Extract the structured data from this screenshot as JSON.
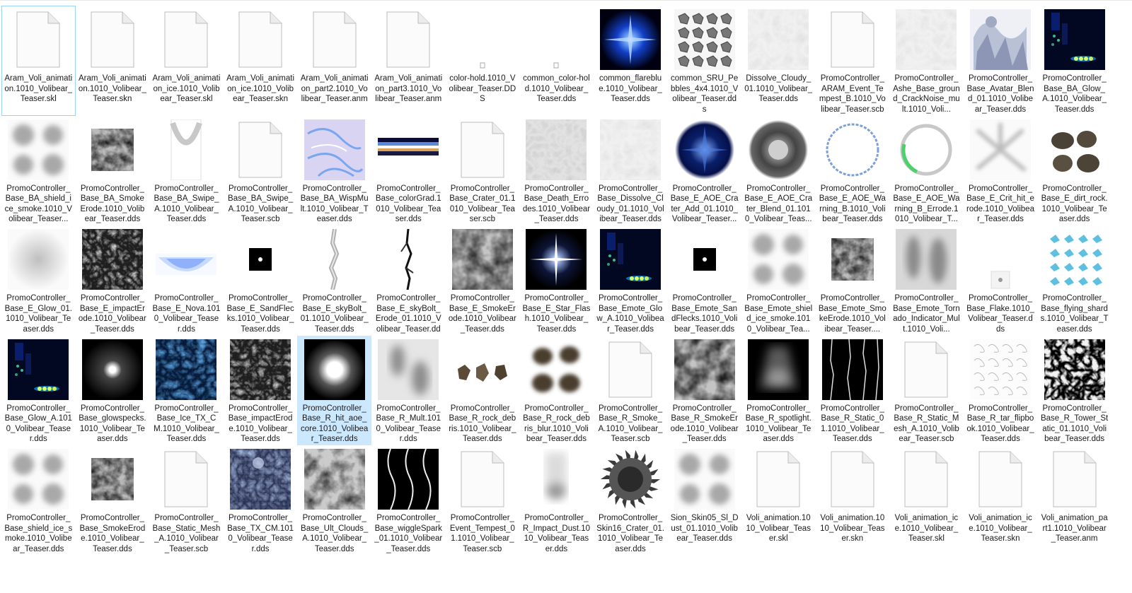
{
  "window": {
    "view": "Large icons"
  },
  "files": [
    {
      "name": "Aram_Voli_animation.1010_Volibear_Teaser.skl",
      "icon": "blank-file-icon",
      "focused": true
    },
    {
      "name": "Aram_Voli_animation.1010_Volibear_Teaser.skn",
      "icon": "blank-file-icon"
    },
    {
      "name": "Aram_Voli_animation_ice.1010_Volibear_Teaser.skl",
      "icon": "blank-file-icon"
    },
    {
      "name": "Aram_Voli_animation_ice.1010_Volibear_Teaser.skn",
      "icon": "blank-file-icon"
    },
    {
      "name": "Aram_Voli_animation_part2.1010_Volibear_Teaser.anm",
      "icon": "blank-file-icon"
    },
    {
      "name": "Aram_Voli_animation_part3.1010_Volibear_Teaser.anm",
      "icon": "blank-file-icon"
    },
    {
      "name": "color-hold.1010_Volibear_Teaser.DDS",
      "icon": "tiny-pixel-icon"
    },
    {
      "name": "common_color-hold.1010_Volibear_Teaser.dds",
      "icon": "tiny-pixel-icon"
    },
    {
      "name": "common_flareblue.1010_Volibear_Teaser.dds",
      "icon": "blue-flare-thumbnail"
    },
    {
      "name": "common_SRU_Pebbles_4x4.1010_Volibear_Teaser.dds",
      "icon": "pebbles-grid-thumbnail"
    },
    {
      "name": "Dissolve_Cloudy_01.1010_Volibear_Teaser.dds",
      "icon": "light-cloud-thumbnail"
    },
    {
      "name": "PromoController_ARAM_Event_Tempest_B.1010_Volibear_Teaser.scb",
      "icon": "blank-file-icon"
    },
    {
      "name": "PromoController_Ashe_Base_ground_CrackNoise_mult.1010_Voli...",
      "icon": "light-cloud-thumbnail"
    },
    {
      "name": "PromoController_Base_Avatar_Blend_01.1010_Volibear_Teaser.dds",
      "icon": "avatar-blend-thumbnail"
    },
    {
      "name": "PromoController_Base_BA_Glow_A.1010_Volibear_Teaser.dds",
      "icon": "dark-glow-thumbnail"
    },
    {
      "name": "PromoController_Base_BA_shield_ice_smoke.1010_Volibear_Teaser...",
      "icon": "smoke-quad-thumbnail"
    },
    {
      "name": "PromoController_Base_BA_SmokeErode.1010_Volibear_Teaser.dds",
      "icon": "swirl-smoke-small-thumbnail"
    },
    {
      "name": "PromoController_Base_BA_Swipe_A.1010_Volibear_Teaser.dds",
      "icon": "swipe-thumbnail"
    },
    {
      "name": "PromoController_Base_BA_Swipe_A.1010_Volibear_Teaser.scb",
      "icon": "blank-file-icon"
    },
    {
      "name": "PromoController_Base_BA_WispMult.1010_Volibear_Teaser.dds",
      "icon": "wisp-thumbnail"
    },
    {
      "name": "PromoController_Base_colorGrad.1010_Volibear_Teaser.dds",
      "icon": "color-gradient-thumbnail"
    },
    {
      "name": "PromoController_Base_Crater_01.1010_Volibear_Teaser.scb",
      "icon": "blank-file-icon"
    },
    {
      "name": "PromoController_Base_Death_Errodes.1010_Volibear_Teaser.dds",
      "icon": "death-errode-thumbnail"
    },
    {
      "name": "PromoController_Base_Dissolve_Cloudy_01.1010_Volibear_Teaser.dds",
      "icon": "light-cloud-thumbnail"
    },
    {
      "name": "PromoController_Base_E_AOE_Crater_Add_01.1010_Volibear_Teaser...",
      "icon": "blue-crater-thumbnail"
    },
    {
      "name": "PromoController_Base_E_AOE_Crater_Blend_01.1010_Volibear_Teas...",
      "icon": "gray-crater-thumbnail"
    },
    {
      "name": "PromoController_Base_E_AOE_Warning_B.1010_Volibear_Teaser.dds",
      "icon": "blue-ring-thumbnail"
    },
    {
      "name": "PromoController_Base_E_AOE_Warning_B_Errode.1010_Volibear_T...",
      "icon": "green-ring-thumbnail"
    },
    {
      "name": "PromoController_Base_E_Crit_hit_erode.1010_Volibear_Teaser.dds",
      "icon": "crit-hit-thumbnail"
    },
    {
      "name": "PromoController_Base_E_dirt_rock.1010_Volibear_Teaser.dds",
      "icon": "dirt-rock-thumbnail"
    },
    {
      "name": "PromoController_Base_E_Glow_01.1010_Volibear_Teaser.dds",
      "icon": "soft-glow-thumbnail"
    },
    {
      "name": "PromoController_Base_E_impactErode.1010_Volibear_Teaser.dds",
      "icon": "dark-noise-thumbnail"
    },
    {
      "name": "PromoController_Base_E_Nova.1010_Volibear_Teaser.dds",
      "icon": "nova-thumbnail"
    },
    {
      "name": "PromoController_Base_E_SandFlecks.1010_Volibear_Teaser.dds",
      "icon": "small-black-thumbnail"
    },
    {
      "name": "PromoController_Base_E_skyBolt_01.1010_Volibear_Teaser.dds",
      "icon": "bolt-gray-thumbnail"
    },
    {
      "name": "PromoController_Base_E_skyBolt_Erode_01.1010_Volibear_Teaser.dds",
      "icon": "bolt-black-thumbnail"
    },
    {
      "name": "PromoController_Base_E_SmokeErode.1010_Volibear_Teaser.dds",
      "icon": "swirl-smoke-thumbnail"
    },
    {
      "name": "PromoController_Base_E_Star_Flash.1010_Volibear_Teaser.dds",
      "icon": "star-flash-thumbnail"
    },
    {
      "name": "PromoController_Base_Emote_Glow_A.1010_Volibear_Teaser.dds",
      "icon": "dark-glow-thumbnail"
    },
    {
      "name": "PromoController_Base_Emote_SandFlecks.1010_Volibear_Teaser.dds",
      "icon": "small-black-thumbnail"
    },
    {
      "name": "PromoController_Base_Emote_shield_ice_smoke.1010_Volibear_Tea...",
      "icon": "smoke-quad-thumbnail"
    },
    {
      "name": "PromoController_Base_Emote_SmokeErode.1010_Volibear_Teaser....",
      "icon": "swirl-smoke-small-thumbnail"
    },
    {
      "name": "PromoController_Base_Emote_Tornado_Indicator_Mult.1010_Voli...",
      "icon": "tornado-thumbnail"
    },
    {
      "name": "PromoController_Base_Flake.1010_Volibear_Teaser.dds",
      "icon": "flake-thumbnail"
    },
    {
      "name": "PromoController_Base_flying_shards.1010_Volibear_Teaser.dds",
      "icon": "shards-thumbnail"
    },
    {
      "name": "PromoController_Base_Glow_A.1010_Volibear_Teaser.dds",
      "icon": "dark-glow-thumbnail"
    },
    {
      "name": "PromoController_Base_glowspecks.1010_Volibear_Teaser.dds",
      "icon": "glow-speck-thumbnail"
    },
    {
      "name": "PromoController_Base_Ice_TX_CM.1010_Volibear_Teaser.dds",
      "icon": "ice-texture-thumbnail"
    },
    {
      "name": "PromoController_Base_impactErode.1010_Volibear_Teaser.dds",
      "icon": "dark-noise-thumbnail"
    },
    {
      "name": "PromoController_Base_R_hit_aoe_core.1010_Volibear_Teaser.dds",
      "icon": "hit-core-thumbnail",
      "selected": true
    },
    {
      "name": "PromoController_Base_R_Mult.1010_Volibear_Teaser.dds",
      "icon": "r-mult-thumbnail"
    },
    {
      "name": "PromoController_Base_R_rock_debris.1010_Volibear_Teaser.dds",
      "icon": "rock-debris-thumbnail"
    },
    {
      "name": "PromoController_Base_R_rock_debris_blur.1010_Volibear_Teaser.dds",
      "icon": "rock-blur-thumbnail"
    },
    {
      "name": "PromoController_Base_R_Smoke_A.1010_Volibear_Teaser.scb",
      "icon": "blank-file-icon"
    },
    {
      "name": "PromoController_Base_R_SmokeErode.1010_Volibear_Teaser.dds",
      "icon": "swirl-smoke-thumbnail"
    },
    {
      "name": "PromoController_Base_R_spotlight.1010_Volibear_Teaser.dds",
      "icon": "spotlight-thumbnail"
    },
    {
      "name": "PromoController_Base_R_Static_01.1010_Volibear_Teaser.dds",
      "icon": "static-lines-thumbnail"
    },
    {
      "name": "PromoController_Base_R_Static_Mesh_A.1010_Volibear_Teaser.scb",
      "icon": "blank-file-icon"
    },
    {
      "name": "PromoController_Base_R_tar_flipbook.1010_Volibear_Teaser.dds",
      "icon": "tar-flipbook-thumbnail"
    },
    {
      "name": "PromoController_Base_R_Tower_Static_01.1010_Volibear_Teaser.dds",
      "icon": "tower-static-thumbnail"
    },
    {
      "name": "PromoController_Base_shield_ice_smoke.1010_Volibear_Teaser.dds",
      "icon": "smoke-quad-thumbnail"
    },
    {
      "name": "PromoController_Base_SmokeErode.1010_Volibear_Teaser.dds",
      "icon": "swirl-smoke-small-thumbnail"
    },
    {
      "name": "PromoController_Base_Static_Mesh_A.1010_Volibear_Teaser.scb",
      "icon": "blank-file-icon"
    },
    {
      "name": "PromoController_Base_TX_CM.1010_Volibear_Teaser.dds",
      "icon": "tx-cm-thumbnail"
    },
    {
      "name": "PromoController_Base_Ult_Clouds_A.1010_Volibear_Teaser.dds",
      "icon": "ult-clouds-thumbnail"
    },
    {
      "name": "PromoController_Base_wiggleSpark_01.1010_Volibear_Teaser.dds",
      "icon": "wiggle-spark-thumbnail"
    },
    {
      "name": "PromoController_Event_Tempest_01.1010_Volibear_Teaser.scb",
      "icon": "blank-file-icon"
    },
    {
      "name": "PromoController_R_Impact_Dust.1010_Volibear_Teaser.dds",
      "icon": "impact-dust-thumbnail"
    },
    {
      "name": "PromoController_Skin16_Crater_01.1010_Volibear_Teaser.dds",
      "icon": "gear-crater-thumbnail"
    },
    {
      "name": "Sion_Skin05_Sl_Dust_01.1010_Volibear_Teaser.dds",
      "icon": "smoke-quad-thumbnail"
    },
    {
      "name": "Voli_animation.1010_Volibear_Teaser.skl",
      "icon": "blank-file-icon"
    },
    {
      "name": "Voli_animation.1010_Volibear_Teaser.skn",
      "icon": "blank-file-icon"
    },
    {
      "name": "Voli_animation_ice.1010_Volibear_Teaser.skl",
      "icon": "blank-file-icon"
    },
    {
      "name": "Voli_animation_ice.1010_Volibear_Teaser.skn",
      "icon": "blank-file-icon"
    },
    {
      "name": "Voli_animation_part1.1010_Volibear_Teaser.anm",
      "icon": "blank-file-icon"
    }
  ]
}
